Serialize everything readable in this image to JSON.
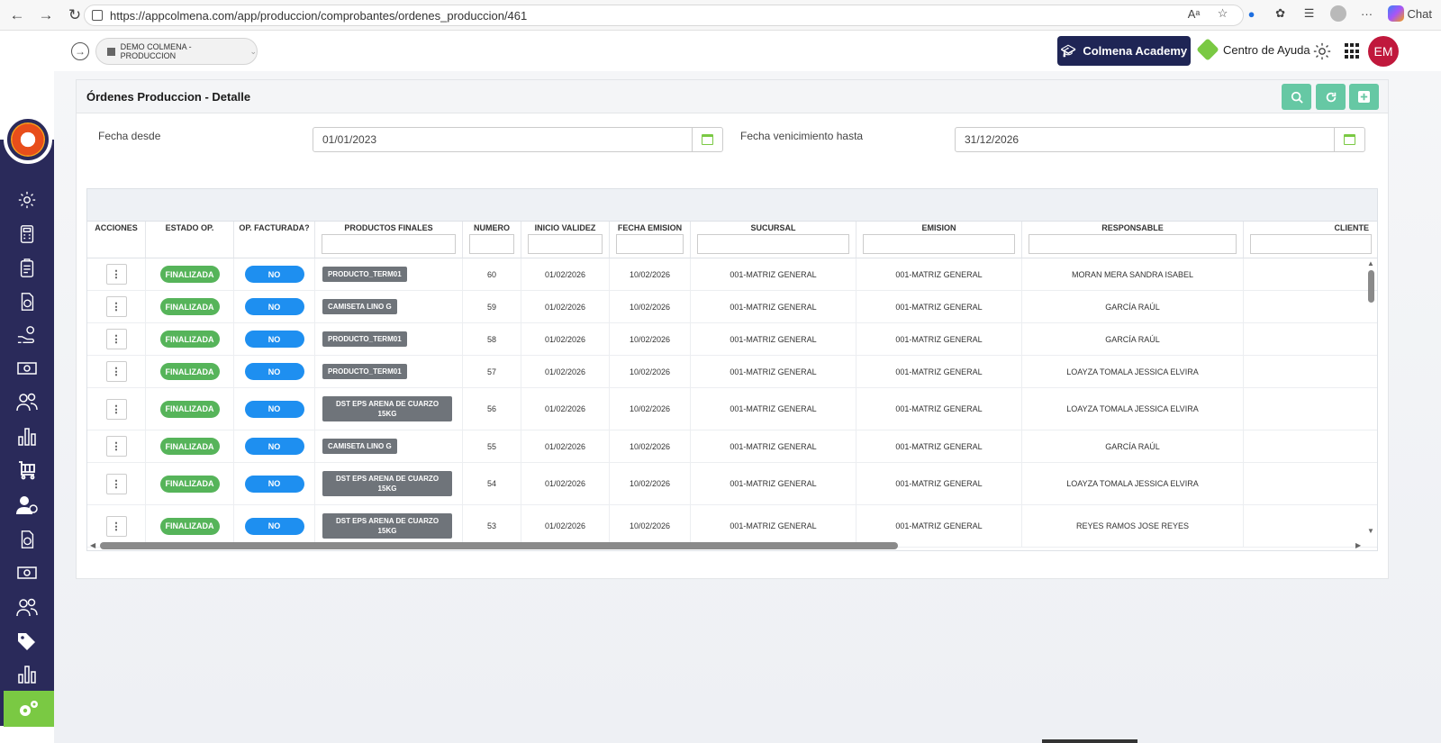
{
  "browser": {
    "url": "https://appcolmena.com/app/produccion/comprobantes/ordenes_produccion/461",
    "chat_label": "Chat",
    "read_aloud": "Aᵃ",
    "more": "···"
  },
  "header": {
    "company": "DEMO COLMENA - PRODUCCION",
    "academy_label": "Colmena Academy",
    "help_label": "Centro de Ayuda",
    "user_initials": "EM"
  },
  "page": {
    "title": "Órdenes Produccion - Detalle"
  },
  "filters": {
    "from_label": "Fecha desde",
    "from_value": "01/01/2023",
    "to_label": "Fecha venicimiento hasta",
    "to_value": "31/12/2026"
  },
  "table": {
    "headers": [
      "ACCIONES",
      "ESTADO OP.",
      "OP. FACTURADA?",
      "PRODUCTOS FINALES",
      "NUMERO",
      "INICIO VALIDEZ",
      "FECHA EMISION",
      "SUCURSAL",
      "EMISION",
      "RESPONSABLE",
      "CLIENTE"
    ],
    "rows": [
      {
        "action": "⋮",
        "estado": "FINALIZADA",
        "facturada": "NO",
        "producto": "PRODUCTO_TERM01",
        "numero": "60",
        "inicio": "01/02/2026",
        "emision_fecha": "10/02/2026",
        "sucursal": "001-MATRIZ GENERAL",
        "emision": "001-MATRIZ GENERAL",
        "responsable": "MORAN MERA SANDRA ISABEL",
        "cliente": ""
      },
      {
        "action": "⋮",
        "estado": "FINALIZADA",
        "facturada": "NO",
        "producto": "CAMISETA LINO G",
        "numero": "59",
        "inicio": "01/02/2026",
        "emision_fecha": "10/02/2026",
        "sucursal": "001-MATRIZ GENERAL",
        "emision": "001-MATRIZ GENERAL",
        "responsable": "GARCÍA RAÚL",
        "cliente": ""
      },
      {
        "action": "⋮",
        "estado": "FINALIZADA",
        "facturada": "NO",
        "producto": "PRODUCTO_TERM01",
        "numero": "58",
        "inicio": "01/02/2026",
        "emision_fecha": "10/02/2026",
        "sucursal": "001-MATRIZ GENERAL",
        "emision": "001-MATRIZ GENERAL",
        "responsable": "GARCÍA RAÚL",
        "cliente": ""
      },
      {
        "action": "⋮",
        "estado": "FINALIZADA",
        "facturada": "NO",
        "producto": "PRODUCTO_TERM01",
        "numero": "57",
        "inicio": "01/02/2026",
        "emision_fecha": "10/02/2026",
        "sucursal": "001-MATRIZ GENERAL",
        "emision": "001-MATRIZ GENERAL",
        "responsable": "LOAYZA TOMALA JESSICA ELVIRA",
        "cliente": ""
      },
      {
        "action": "⋮",
        "estado": "FINALIZADA",
        "facturada": "NO",
        "producto": "DST EPS ARENA DE CUARZO 15KG",
        "numero": "56",
        "inicio": "01/02/2026",
        "emision_fecha": "10/02/2026",
        "sucursal": "001-MATRIZ GENERAL",
        "emision": "001-MATRIZ GENERAL",
        "responsable": "LOAYZA TOMALA JESSICA ELVIRA",
        "cliente": ""
      },
      {
        "action": "⋮",
        "estado": "FINALIZADA",
        "facturada": "NO",
        "producto": "CAMISETA LINO G",
        "numero": "55",
        "inicio": "01/02/2026",
        "emision_fecha": "10/02/2026",
        "sucursal": "001-MATRIZ GENERAL",
        "emision": "001-MATRIZ GENERAL",
        "responsable": "GARCÍA RAÚL",
        "cliente": ""
      },
      {
        "action": "⋮",
        "estado": "FINALIZADA",
        "facturada": "NO",
        "producto": "DST EPS ARENA DE CUARZO 15KG",
        "numero": "54",
        "inicio": "01/02/2026",
        "emision_fecha": "10/02/2026",
        "sucursal": "001-MATRIZ GENERAL",
        "emision": "001-MATRIZ GENERAL",
        "responsable": "LOAYZA TOMALA JESSICA ELVIRA",
        "cliente": ""
      },
      {
        "action": "⋮",
        "estado": "FINALIZADA",
        "facturada": "NO",
        "producto": "DST EPS ARENA DE CUARZO 15KG",
        "numero": "53",
        "inicio": "01/02/2026",
        "emision_fecha": "10/02/2026",
        "sucursal": "001-MATRIZ GENERAL",
        "emision": "001-MATRIZ GENERAL",
        "responsable": "REYES RAMOS JOSE REYES",
        "cliente": ""
      }
    ]
  },
  "colors": {
    "sidebar": "#2a2a5a",
    "accent_green": "#7ac943",
    "tool_button": "#66c8a4",
    "status_green": "#56b45a",
    "status_blue": "#1e8ff0",
    "avatar": "#c0183c"
  },
  "icons": {
    "sidebar": [
      "settings-gear-icon",
      "calculator-icon",
      "clipboard-icon",
      "invoice-dollar-icon",
      "hand-coins-icon",
      "cash-icon",
      "users-icon",
      "bar-chart-icon",
      "cart-icon",
      "user-admin-icon",
      "invoice-dollar-icon",
      "cash-icon",
      "users-icon",
      "tags-icon",
      "bar-chart-icon",
      "production-gears-icon"
    ],
    "toolbar": [
      "search-icon",
      "refresh-icon",
      "add-icon"
    ]
  }
}
